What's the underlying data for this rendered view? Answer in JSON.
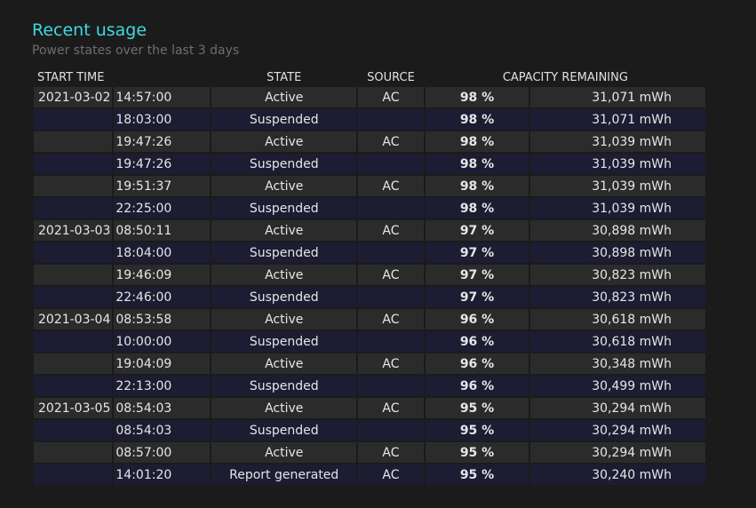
{
  "section": {
    "title": "Recent usage",
    "subtitle": "Power states over the last 3 days"
  },
  "table": {
    "headers": {
      "start_time": "START TIME",
      "state": "STATE",
      "source": "SOURCE",
      "capacity": "CAPACITY REMAINING"
    },
    "rows": [
      {
        "date": "2021-03-02",
        "time": "14:57:00",
        "state": "Active",
        "source": "AC",
        "pct": "98 %",
        "mwh": "31,071 mWh"
      },
      {
        "date": "",
        "time": "18:03:00",
        "state": "Suspended",
        "source": "",
        "pct": "98 %",
        "mwh": "31,071 mWh"
      },
      {
        "date": "",
        "time": "19:47:26",
        "state": "Active",
        "source": "AC",
        "pct": "98 %",
        "mwh": "31,039 mWh"
      },
      {
        "date": "",
        "time": "19:47:26",
        "state": "Suspended",
        "source": "",
        "pct": "98 %",
        "mwh": "31,039 mWh"
      },
      {
        "date": "",
        "time": "19:51:37",
        "state": "Active",
        "source": "AC",
        "pct": "98 %",
        "mwh": "31,039 mWh"
      },
      {
        "date": "",
        "time": "22:25:00",
        "state": "Suspended",
        "source": "",
        "pct": "98 %",
        "mwh": "31,039 mWh"
      },
      {
        "date": "2021-03-03",
        "time": "08:50:11",
        "state": "Active",
        "source": "AC",
        "pct": "97 %",
        "mwh": "30,898 mWh"
      },
      {
        "date": "",
        "time": "18:04:00",
        "state": "Suspended",
        "source": "",
        "pct": "97 %",
        "mwh": "30,898 mWh"
      },
      {
        "date": "",
        "time": "19:46:09",
        "state": "Active",
        "source": "AC",
        "pct": "97 %",
        "mwh": "30,823 mWh"
      },
      {
        "date": "",
        "time": "22:46:00",
        "state": "Suspended",
        "source": "",
        "pct": "97 %",
        "mwh": "30,823 mWh"
      },
      {
        "date": "2021-03-04",
        "time": "08:53:58",
        "state": "Active",
        "source": "AC",
        "pct": "96 %",
        "mwh": "30,618 mWh"
      },
      {
        "date": "",
        "time": "10:00:00",
        "state": "Suspended",
        "source": "",
        "pct": "96 %",
        "mwh": "30,618 mWh"
      },
      {
        "date": "",
        "time": "19:04:09",
        "state": "Active",
        "source": "AC",
        "pct": "96 %",
        "mwh": "30,348 mWh"
      },
      {
        "date": "",
        "time": "22:13:00",
        "state": "Suspended",
        "source": "",
        "pct": "96 %",
        "mwh": "30,499 mWh"
      },
      {
        "date": "2021-03-05",
        "time": "08:54:03",
        "state": "Active",
        "source": "AC",
        "pct": "95 %",
        "mwh": "30,294 mWh"
      },
      {
        "date": "",
        "time": "08:54:03",
        "state": "Suspended",
        "source": "",
        "pct": "95 %",
        "mwh": "30,294 mWh"
      },
      {
        "date": "",
        "time": "08:57:00",
        "state": "Active",
        "source": "AC",
        "pct": "95 %",
        "mwh": "30,294 mWh"
      },
      {
        "date": "",
        "time": "14:01:20",
        "state": "Report generated",
        "source": "AC",
        "pct": "95 %",
        "mwh": "30,240 mWh"
      }
    ]
  },
  "colors": {
    "title": "#3fd9e0",
    "row_odd": "#2b2b2b",
    "row_even": "#1c1c33"
  }
}
